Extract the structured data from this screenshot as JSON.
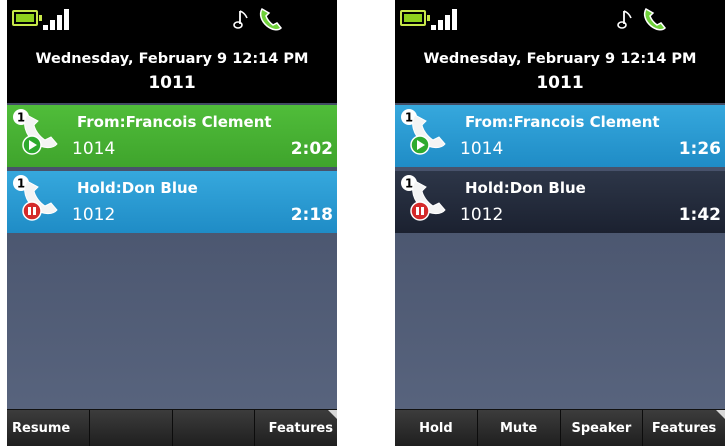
{
  "left": {
    "header": {
      "date": "Wednesday, February 9 12:14 PM",
      "extension": "1011"
    },
    "calls": [
      {
        "badge": "1",
        "label": "From:Francois Clement",
        "number": "1014",
        "timer": "2:02",
        "state": "active"
      },
      {
        "badge": "1",
        "label": "Hold:Don Blue",
        "number": "1012",
        "timer": "2:18",
        "state": "hold"
      }
    ],
    "softkeys": [
      "Resume",
      "",
      "",
      "Features"
    ]
  },
  "right": {
    "header": {
      "date": "Wednesday, February 9 12:14 PM",
      "extension": "1011"
    },
    "calls": [
      {
        "badge": "1",
        "label": "From:Francois Clement",
        "number": "1014",
        "timer": "1:26",
        "state": "active"
      },
      {
        "badge": "1",
        "label": "Hold:Don Blue",
        "number": "1012",
        "timer": "1:42",
        "state": "hold"
      }
    ],
    "softkeys": [
      "Hold",
      "Mute",
      "Speaker",
      "Features"
    ]
  },
  "colors": {
    "active_green": "#3fa42c",
    "selected_blue": "#1f8cc6",
    "hold_dark": "#1b2130",
    "battery": "#8fd11c",
    "hold_red": "#d42a2a"
  },
  "icons": {
    "status": [
      "battery-icon",
      "signal-icon",
      "music-note-icon",
      "handset-icon"
    ],
    "call_active": "active-call-icon",
    "call_hold": "held-call-icon"
  }
}
